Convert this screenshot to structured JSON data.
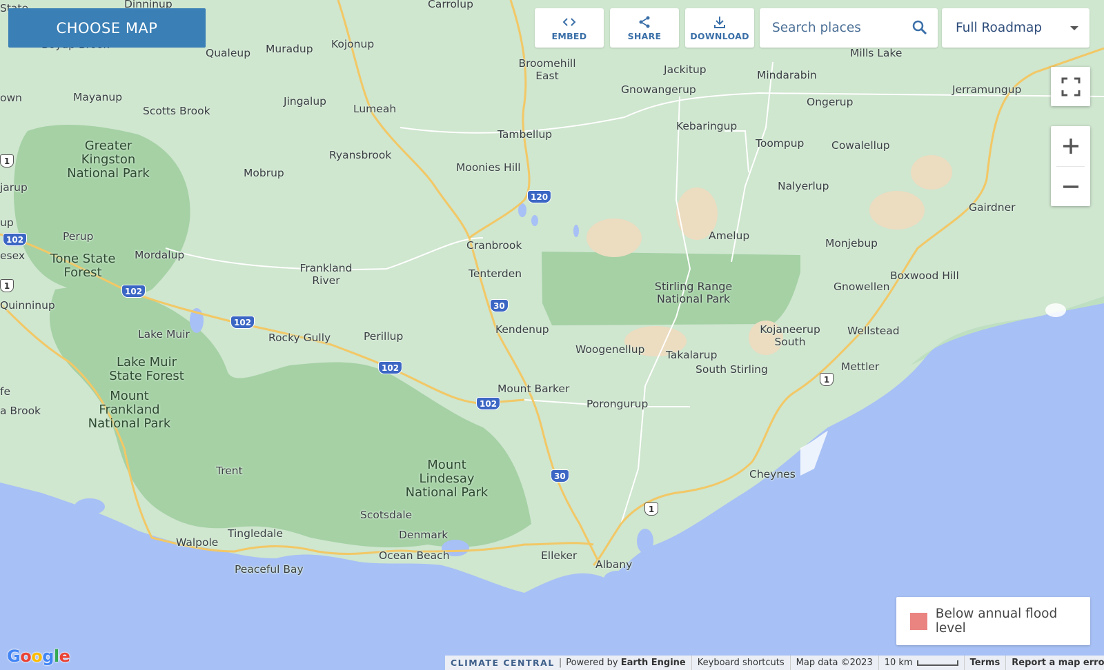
{
  "controls": {
    "choose_map": "CHOOSE MAP",
    "embed": "EMBED",
    "share": "SHARE",
    "download": "DOWNLOAD",
    "search_placeholder": "Search places",
    "map_type": "Full Roadmap",
    "icons": [
      "code-icon",
      "share-icon",
      "download-icon",
      "search-icon",
      "fullscreen-icon",
      "zoom-in-icon",
      "zoom-out-icon"
    ]
  },
  "legend": {
    "label": "Below annual flood level",
    "color": "#ea8481"
  },
  "footer": {
    "logo": "Google",
    "climate_central": "CLIMATE CENTRAL",
    "powered_by": "Powered by",
    "earth_engine": "Earth Engine",
    "keyboard": "Keyboard shortcuts",
    "map_data": "Map data ©2023",
    "scale": "10 km",
    "terms": "Terms",
    "report": "Report a map error"
  },
  "places": [
    "State",
    "Dinninup",
    "Carrolup",
    "Boyup Brook",
    "Qualeup",
    "Muradup",
    "Kojonup",
    "Broomehill East",
    "Jackitup",
    "Mindarabin",
    "Mills Lake",
    "Jerramungup",
    "own",
    "Mayanup",
    "Scotts Brook",
    "Jingalup",
    "Lumeah",
    "Gnowangerup",
    "Ongerup",
    "Kebaringup",
    "Tambellup",
    "Toompup",
    "Cowalellup",
    "Ryansbrook",
    "Mobrup",
    "Moonies Hill",
    "Nalyerlup",
    "jarup",
    "Gairdner",
    "up",
    "Amelup",
    "Perup",
    "Cranbrook",
    "Monjebup",
    "Mordalup",
    "esex",
    "Frankland River",
    "Tenterden",
    "Boxwood Hill",
    "Gnowellen",
    "Quinninup",
    "Lake Muir",
    "Rocky Gully",
    "Perillup",
    "Kendenup",
    "Kojaneerup South",
    "Wellstead",
    "Woogenellup",
    "Takalarup",
    "South Stirling",
    "Mettler",
    "fe",
    "a Brook",
    "Mount Barker",
    "Porongurup",
    "Trent",
    "Cheynes",
    "Scotsdale",
    "Tingledale",
    "Walpole",
    "Denmark",
    "Ocean Beach",
    "Elleker",
    "Albany",
    "Peaceful Bay"
  ],
  "parks": [
    "Greater Kingston National Park",
    "Tone State Forest",
    "Lake Muir State Forest",
    "Mount Frankland National Park",
    "Mount Lindesay National Park",
    "Stirling Range National Park"
  ],
  "road_shields": [
    "102",
    "102",
    "102",
    "102",
    "102",
    "120",
    "30",
    "30",
    "1",
    "1",
    "1",
    "1"
  ],
  "colors": {
    "land": "#cfe6cf",
    "park": "#a5d1a5",
    "water": "#a7c0f5",
    "road": "#f2c866",
    "accent": "#3a7fb5"
  }
}
